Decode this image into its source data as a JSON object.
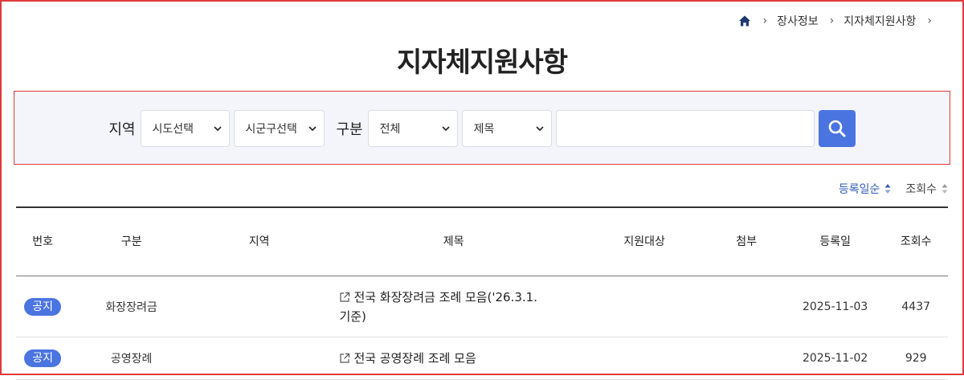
{
  "breadcrumb": {
    "items": [
      "장사정보",
      "지자체지원사항"
    ],
    "home_icon": "home-icon",
    "separator_icon": "chevron-right-icon"
  },
  "page_title": "지자체지원사항",
  "search": {
    "region_label": "지역",
    "sido_select": "시도선택",
    "sigungu_select": "시군구선택",
    "category_label": "구분",
    "category_select": "전체",
    "field_select": "제목",
    "keyword_value": "",
    "search_icon": "search-icon",
    "accent_color": "#4a74e0"
  },
  "sort": {
    "options": [
      {
        "label": "등록일순",
        "active": true
      },
      {
        "label": "조회수",
        "active": false
      }
    ],
    "active_color": "#2f5db8"
  },
  "table": {
    "columns": [
      "번호",
      "구분",
      "지역",
      "제목",
      "지원대상",
      "첨부",
      "등록일",
      "조회수"
    ],
    "rows": [
      {
        "number": "공지",
        "category": "화장장려금",
        "region": "",
        "title": "전국 화장장려금 조례 모음('26.3.1. 기준)",
        "target": "",
        "attachment": "",
        "date": "2025-11-03",
        "views": "4437"
      },
      {
        "number": "공지",
        "category": "공영장례",
        "region": "",
        "title": "전국 공영장례 조례 모음",
        "target": "",
        "attachment": "",
        "date": "2025-11-02",
        "views": "929"
      }
    ],
    "badge_color": "#4a74e0",
    "link_icon": "external-link-icon"
  }
}
